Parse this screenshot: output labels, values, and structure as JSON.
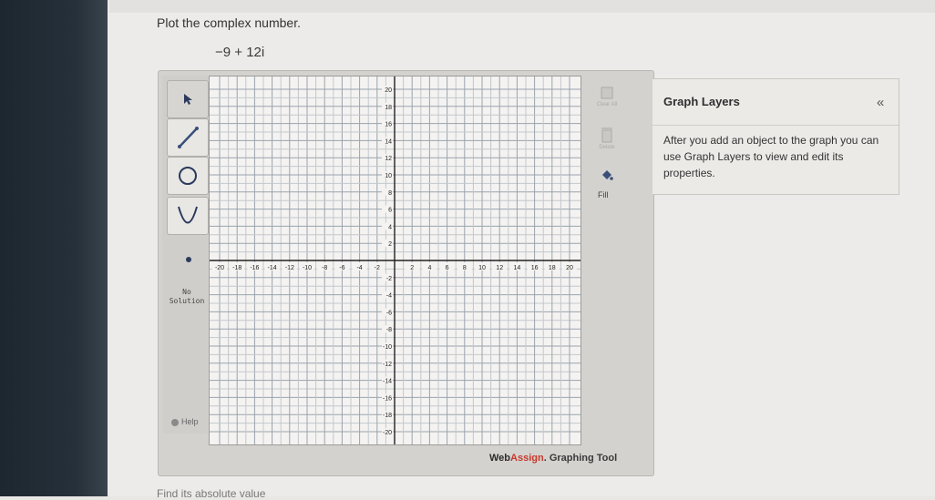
{
  "question": {
    "prompt": "Plot the complex number.",
    "number": "−9 + 12i"
  },
  "toolbar": {
    "tools": [
      "pointer-tool",
      "line-tool",
      "circle-tool",
      "parabola-tool",
      "point-tool"
    ],
    "no_solution_line1": "No",
    "no_solution_line2": "Solution",
    "help_label": "Help"
  },
  "graph": {
    "x_ticks": [
      "-20",
      "-18",
      "-16",
      "-14",
      "-12",
      "-10",
      "-8",
      "-6",
      "-4",
      "-2",
      "2",
      "4",
      "6",
      "8",
      "10",
      "12",
      "14",
      "16",
      "18",
      "20"
    ],
    "y_ticks": [
      "20",
      "18",
      "16",
      "14",
      "12",
      "10",
      "8",
      "6",
      "4",
      "2",
      "-2",
      "-4",
      "-6",
      "-8",
      "-10",
      "-12",
      "-14",
      "-16",
      "-18",
      "-20"
    ],
    "range": [
      -20,
      20
    ]
  },
  "right_tools": {
    "clear_all_caption": "Clear All",
    "delete_caption": "Delete",
    "fill_label": "Fill"
  },
  "graph_layers": {
    "title": "Graph Layers",
    "collapse": "«",
    "description": "After you add an object to the graph you can use Graph Layers to view and edit its properties."
  },
  "credit": {
    "brand_a": "Web",
    "brand_b": "Assign",
    "suffix": ". Graphing Tool"
  },
  "footer": {
    "text": "Find its absolute value"
  }
}
